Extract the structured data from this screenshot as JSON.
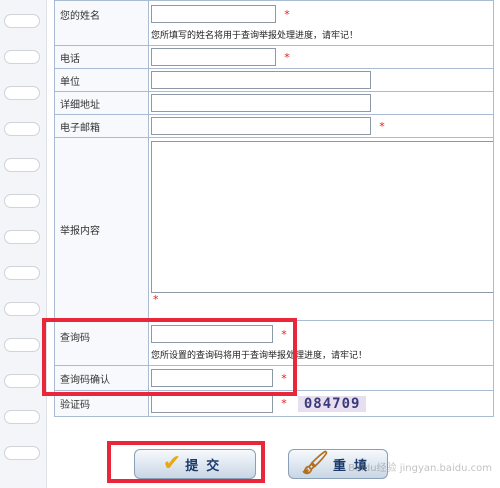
{
  "form": {
    "name_label": "您的姓名",
    "name_value": "",
    "name_hint": "您所填写的姓名将用于查询举报处理进度，请牢记！",
    "phone_label": "电话",
    "phone_value": "",
    "unit_label": "单位",
    "unit_value": "",
    "address_label": "详细地址",
    "address_value": "",
    "email_label": "电子邮箱",
    "email_value": "",
    "content_label": "举报内容",
    "content_value": "",
    "query_code_label": "查询码",
    "query_code_value": "",
    "query_code_hint": "您所设置的查询码将用于查询举报处理进度，请牢记！",
    "query_confirm_label": "查询码确认",
    "query_confirm_value": "",
    "captcha_label": "验证码",
    "captcha_value": "",
    "captcha_image_text": "084709",
    "required_mark": "*"
  },
  "buttons": {
    "submit_label": "提交",
    "reset_label": "重填"
  },
  "icons": {
    "submit": "checkmark-icon",
    "reset": "brush-icon"
  },
  "watermark": "Baidu经验 jingyan.baidu.com",
  "colors": {
    "highlight_box": "#e8273a",
    "required": "#e02020",
    "border": "#a9bcd4"
  }
}
